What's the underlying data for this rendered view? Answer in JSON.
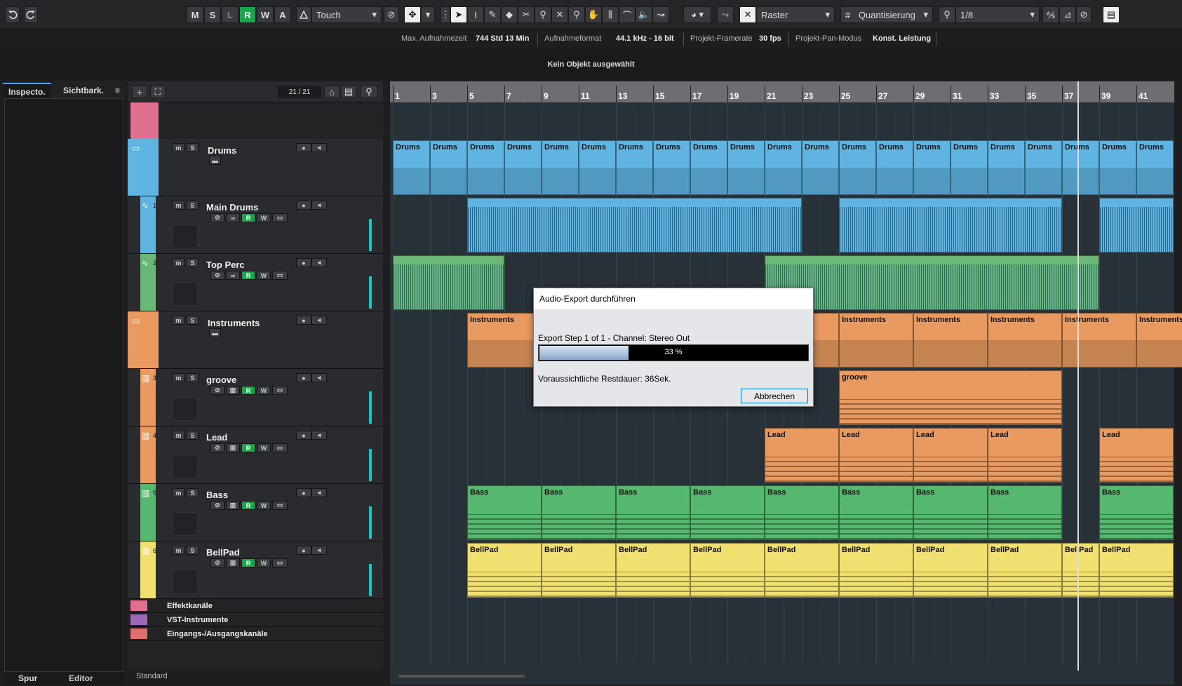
{
  "toolbar": {
    "undo_icon": "undo-icon",
    "redo_icon": "redo-icon",
    "modes": [
      "M",
      "S",
      "L",
      "R",
      "W",
      "A"
    ],
    "automation_mode": "Touch",
    "snap_label": "Raster",
    "quantize_label": "Quantisierung",
    "quantize_value": "1/8"
  },
  "infobar": {
    "max_rec_label": "Max. Aufnahmezeit",
    "max_rec_value": "744 Std 13 Min",
    "rec_format_label": "Aufnahmeformat",
    "rec_format_value": "44.1 kHz - 16 bit",
    "framerate_label": "Projekt-Framerate",
    "framerate_value": "30 fps",
    "pan_label": "Projekt-Pan-Modus",
    "pan_value": "Konst. Leistung"
  },
  "status": {
    "text": "Kein Objekt ausgewählt"
  },
  "inspector": {
    "tab_inspector": "Inspecto.",
    "tab_visibility": "Sichtbark.",
    "bottom_tab_track": "Spur",
    "bottom_tab_editor": "Editor"
  },
  "trackpanel": {
    "counter": "21 / 21",
    "footer_label": "Standard"
  },
  "tracks": [
    {
      "name": "Drums",
      "number": "",
      "type": "folder",
      "color": "#5fb4e2"
    },
    {
      "name": "Main Drums",
      "number": "1",
      "type": "audio",
      "color": "#5fb4e2"
    },
    {
      "name": "Top Perc",
      "number": "2",
      "type": "audio",
      "color": "#6ab876"
    },
    {
      "name": "Instruments",
      "number": "",
      "type": "folder",
      "color": "#e89a60"
    },
    {
      "name": "groove",
      "number": "3",
      "type": "instrument",
      "color": "#e89a60"
    },
    {
      "name": "Lead",
      "number": "4",
      "type": "instrument",
      "color": "#e89a60"
    },
    {
      "name": "Bass",
      "number": "5",
      "type": "instrument",
      "color": "#56b86e"
    },
    {
      "name": "BellPad",
      "number": "6",
      "type": "instrument",
      "color": "#f0e070"
    }
  ],
  "folders": [
    {
      "name": "Effektkanäle",
      "color": "#e07090"
    },
    {
      "name": "VST-Instrumente",
      "color": "#9a6ab8"
    },
    {
      "name": "Eingangs-/Ausgangskanäle",
      "color": "#e07070"
    }
  ],
  "ruler": {
    "bars": [
      "1",
      "3",
      "5",
      "7",
      "9",
      "11",
      "13",
      "15",
      "17",
      "19",
      "21",
      "23",
      "25",
      "27",
      "29",
      "31",
      "33",
      "35",
      "37",
      "39",
      "41"
    ]
  },
  "dialog": {
    "title": "Audio-Export durchführen",
    "step_text": "Export Step 1 of 1  - Channel: Stereo Out",
    "progress": 33,
    "progress_text": "33 %",
    "remaining_text": "Voraussichtliche Restdauer: 36Sek.",
    "cancel_label": "Abbrechen"
  }
}
